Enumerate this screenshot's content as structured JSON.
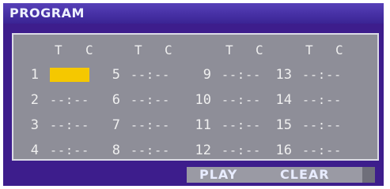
{
  "title": "PROGRAM",
  "column_headers": [
    "T",
    "C",
    "T",
    "C",
    "T",
    "C",
    "T",
    "C"
  ],
  "slots": [
    {
      "num": "1",
      "time": "--:--",
      "active": true
    },
    {
      "num": "2",
      "time": "--:--",
      "active": false
    },
    {
      "num": "3",
      "time": "--:--",
      "active": false
    },
    {
      "num": "4",
      "time": "--:--",
      "active": false
    },
    {
      "num": "5",
      "time": "--:--",
      "active": false
    },
    {
      "num": "6",
      "time": "--:--",
      "active": false
    },
    {
      "num": "7",
      "time": "--:--",
      "active": false
    },
    {
      "num": "8",
      "time": "--:--",
      "active": false
    },
    {
      "num": "9",
      "time": "--:--",
      "active": false
    },
    {
      "num": "10",
      "time": "--:--",
      "active": false
    },
    {
      "num": "11",
      "time": "--:--",
      "active": false
    },
    {
      "num": "12",
      "time": "--:--",
      "active": false
    },
    {
      "num": "13",
      "time": "--:--",
      "active": false
    },
    {
      "num": "14",
      "time": "--:--",
      "active": false
    },
    {
      "num": "15",
      "time": "--:--",
      "active": false
    },
    {
      "num": "16",
      "time": "--:--",
      "active": false
    }
  ],
  "buttons": {
    "play": "PLAY",
    "clear": "CLEAR"
  },
  "colors": {
    "osd_background": "#3d1d8c",
    "panel": "#8e8e98",
    "highlight": "#f5c800",
    "text": "#efefef"
  }
}
